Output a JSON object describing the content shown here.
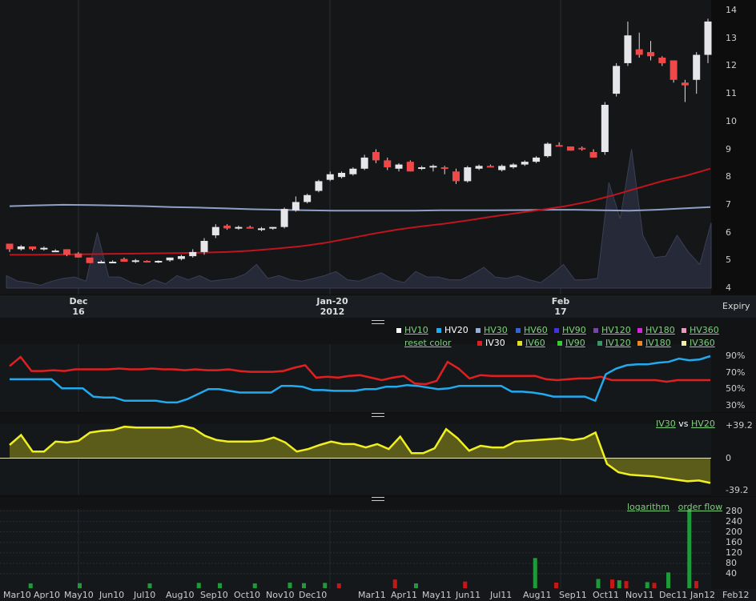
{
  "chart_data": [
    {
      "type": "candlestick",
      "title": "",
      "ylim": [
        4,
        14
      ],
      "y_ticks": [
        "14",
        "13",
        "12",
        "11",
        "10",
        "9",
        "8",
        "7",
        "6",
        "5",
        "4"
      ],
      "x_labels": [
        {
          "top": "Dec",
          "bottom": "16"
        },
        {
          "top": "Jan-20",
          "bottom": "2012"
        },
        {
          "top": "Feb",
          "bottom": "17"
        }
      ],
      "expiry_label": "Expiry",
      "candles": [
        [
          5.6,
          5.6,
          5.3,
          5.4
        ],
        [
          5.4,
          5.55,
          5.35,
          5.5
        ],
        [
          5.5,
          5.5,
          5.35,
          5.4
        ],
        [
          5.45,
          5.5,
          5.35,
          5.45
        ],
        [
          5.35,
          5.4,
          5.3,
          5.35
        ],
        [
          5.4,
          5.4,
          5.15,
          5.2
        ],
        [
          5.25,
          5.3,
          5.1,
          5.1
        ],
        [
          5.1,
          5.1,
          4.9,
          4.9
        ],
        [
          4.95,
          5.0,
          4.9,
          4.95
        ],
        [
          4.95,
          5.0,
          4.9,
          4.95
        ],
        [
          5.05,
          5.1,
          4.95,
          4.95
        ],
        [
          4.95,
          5.05,
          4.9,
          5.0
        ],
        [
          4.98,
          5.0,
          4.92,
          4.96
        ],
        [
          4.95,
          5.0,
          4.9,
          4.98
        ],
        [
          5.0,
          5.1,
          4.95,
          5.1
        ],
        [
          5.05,
          5.2,
          5.0,
          5.15
        ],
        [
          5.15,
          5.4,
          5.1,
          5.3
        ],
        [
          5.3,
          5.8,
          5.2,
          5.7
        ],
        [
          5.9,
          6.3,
          5.8,
          6.2
        ],
        [
          6.25,
          6.3,
          6.1,
          6.15
        ],
        [
          6.2,
          6.25,
          6.1,
          6.2
        ],
        [
          6.2,
          6.25,
          6.15,
          6.15
        ],
        [
          6.1,
          6.2,
          6.05,
          6.15
        ],
        [
          6.15,
          6.2,
          6.1,
          6.2
        ],
        [
          6.2,
          6.9,
          6.15,
          6.85
        ],
        [
          6.8,
          7.3,
          6.75,
          7.1
        ],
        [
          7.1,
          7.4,
          7.05,
          7.35
        ],
        [
          7.5,
          7.9,
          7.45,
          7.85
        ],
        [
          7.9,
          8.2,
          7.85,
          8.1
        ],
        [
          8.0,
          8.2,
          7.95,
          8.15
        ],
        [
          8.1,
          8.35,
          8.05,
          8.3
        ],
        [
          8.3,
          8.8,
          8.25,
          8.7
        ],
        [
          8.9,
          9.0,
          8.5,
          8.6
        ],
        [
          8.6,
          8.7,
          8.25,
          8.35
        ],
        [
          8.3,
          8.5,
          8.2,
          8.45
        ],
        [
          8.55,
          8.6,
          8.2,
          8.2
        ],
        [
          8.3,
          8.4,
          8.25,
          8.35
        ],
        [
          8.35,
          8.45,
          8.2,
          8.4
        ],
        [
          8.35,
          8.4,
          8.1,
          8.3
        ],
        [
          8.2,
          8.3,
          7.75,
          7.85
        ],
        [
          7.85,
          8.4,
          7.8,
          8.35
        ],
        [
          8.3,
          8.45,
          8.25,
          8.4
        ],
        [
          8.4,
          8.45,
          8.35,
          8.38
        ],
        [
          8.25,
          8.45,
          8.2,
          8.4
        ],
        [
          8.35,
          8.5,
          8.3,
          8.45
        ],
        [
          8.45,
          8.6,
          8.4,
          8.55
        ],
        [
          8.55,
          8.75,
          8.5,
          8.7
        ],
        [
          8.75,
          9.25,
          8.7,
          9.2
        ],
        [
          9.15,
          9.25,
          9.1,
          9.1
        ],
        [
          9.1,
          9.1,
          8.95,
          8.95
        ],
        [
          9.05,
          9.1,
          8.95,
          9.0
        ],
        [
          8.9,
          9.0,
          8.7,
          8.7
        ],
        [
          8.9,
          10.7,
          8.8,
          10.6
        ],
        [
          11.0,
          12.1,
          10.9,
          12.0
        ],
        [
          12.1,
          13.6,
          12.0,
          13.1
        ],
        [
          12.6,
          13.2,
          12.3,
          12.4
        ],
        [
          12.5,
          12.9,
          12.2,
          12.35
        ],
        [
          12.3,
          12.35,
          12.0,
          12.1
        ],
        [
          12.2,
          12.2,
          11.4,
          11.5
        ],
        [
          11.4,
          11.5,
          10.7,
          11.3
        ],
        [
          11.5,
          12.5,
          11.0,
          12.4
        ],
        [
          12.4,
          13.7,
          12.1,
          13.6
        ]
      ],
      "ma_red": [
        5.2,
        5.2,
        5.21,
        5.22,
        5.23,
        5.24,
        5.25,
        5.26,
        5.28,
        5.3,
        5.35,
        5.42,
        5.5,
        5.62,
        5.78,
        5.95,
        6.1,
        6.22,
        6.32,
        6.44,
        6.58,
        6.7,
        6.82,
        6.95,
        7.12,
        7.35,
        7.6,
        7.85,
        8.05,
        8.3
      ],
      "ma_blue": [
        6.95,
        6.98,
        7.0,
        6.99,
        6.97,
        6.95,
        6.92,
        6.9,
        6.87,
        6.84,
        6.82,
        6.8,
        6.79,
        6.79,
        6.79,
        6.79,
        6.8,
        6.8,
        6.8,
        6.81,
        6.82,
        6.82,
        6.8,
        6.79,
        6.82,
        6.87,
        6.92
      ],
      "volume_area": [
        4.45,
        4.25,
        4.2,
        4.1,
        4.25,
        4.35,
        4.4,
        4.25,
        6.0,
        4.4,
        4.4,
        4.2,
        4.1,
        4.3,
        4.15,
        4.45,
        4.3,
        4.45,
        4.25,
        4.3,
        4.35,
        4.5,
        4.85,
        4.35,
        4.45,
        4.3,
        4.25,
        4.35,
        4.45,
        4.6,
        4.3,
        4.25,
        4.4,
        4.55,
        4.3,
        4.2,
        4.6,
        4.4,
        4.4,
        4.3,
        4.3,
        4.5,
        4.75,
        4.4,
        4.35,
        4.45,
        4.3,
        4.2,
        4.5,
        4.85,
        4.3,
        4.3,
        4.35,
        7.8,
        6.5,
        9.0,
        5.9,
        5.1,
        5.15,
        5.9,
        5.3,
        4.85,
        6.35
      ]
    },
    {
      "type": "line",
      "title": "",
      "y_ticks": [
        "90%",
        "70%",
        "50%",
        "30%"
      ],
      "ylim": [
        30,
        90
      ],
      "series": [
        {
          "name": "IV30",
          "color": "#e02020",
          "values": [
            78,
            89,
            72,
            72,
            73,
            72,
            74,
            74,
            74,
            74,
            75,
            74,
            74,
            75,
            74,
            74,
            73,
            74,
            73,
            73,
            74,
            72,
            71,
            71,
            71,
            72,
            76,
            79,
            64,
            65,
            64,
            66,
            67,
            64,
            61,
            64,
            66,
            57,
            56,
            60,
            83,
            75,
            63,
            67,
            66,
            66,
            66,
            66,
            66,
            62,
            61,
            62,
            63,
            63,
            65,
            61,
            61,
            61,
            61,
            61,
            59,
            61,
            61,
            61,
            61
          ]
        },
        {
          "name": "HV20",
          "color": "#22aaee",
          "values": [
            62,
            62,
            62,
            62,
            62,
            51,
            51,
            51,
            41,
            40,
            40,
            36,
            36,
            36,
            36,
            34,
            34,
            38,
            44,
            50,
            50,
            48,
            46,
            46,
            46,
            46,
            54,
            54,
            53,
            49,
            49,
            48,
            48,
            48,
            50,
            50,
            53,
            53,
            55,
            54,
            52,
            50,
            51,
            54,
            54,
            54,
            54,
            54,
            47,
            47,
            46,
            44,
            41,
            41,
            41,
            41,
            36,
            68,
            75,
            79,
            80,
            80,
            82,
            83,
            87,
            85,
            86,
            90
          ]
        }
      ],
      "legend_row1": [
        {
          "label": "HV10",
          "color": "#ffffff",
          "link": true
        },
        {
          "label": "HV20",
          "color": "#22aaee",
          "link": false
        },
        {
          "label": "HV30",
          "color": "#9aaed8",
          "link": true
        },
        {
          "label": "HV60",
          "color": "#3366cc",
          "link": true
        },
        {
          "label": "HV90",
          "color": "#4433dd",
          "link": true
        },
        {
          "label": "HV120",
          "color": "#7744aa",
          "link": true
        },
        {
          "label": "HV180",
          "color": "#dd22dd",
          "link": true
        },
        {
          "label": "HV360",
          "color": "#ee99bb",
          "link": true
        }
      ],
      "legend_row2": [
        {
          "label": "reset color",
          "color": "",
          "link": true
        },
        {
          "label": "IV30",
          "color": "#e02020",
          "link": false
        },
        {
          "label": "IV60",
          "color": "#e0e020",
          "link": true
        },
        {
          "label": "IV90",
          "color": "#33cc33",
          "link": true
        },
        {
          "label": "IV120",
          "color": "#339966",
          "link": true
        },
        {
          "label": "IV180",
          "color": "#ee8822",
          "link": true
        },
        {
          "label": "IV360",
          "color": "#eeeeaa",
          "link": true
        }
      ]
    },
    {
      "type": "area",
      "title": "",
      "series_label_a": "IV30",
      "series_label_vs": "vs",
      "series_label_b": "HV20",
      "y_ticks": [
        "+39.2",
        "0",
        "-39.2"
      ],
      "ylim": [
        -39.2,
        39.2
      ],
      "values": [
        16,
        28,
        8,
        8,
        20,
        19,
        21,
        31,
        33,
        34,
        38,
        37,
        37,
        37,
        37,
        39,
        36,
        27,
        22,
        20,
        20,
        20,
        21,
        25,
        19,
        8,
        11,
        16,
        20,
        17,
        17,
        13,
        17,
        11,
        26,
        6,
        6,
        12,
        35,
        24,
        9,
        15,
        13,
        13,
        20,
        21,
        22,
        23,
        24,
        22,
        24,
        31,
        -7,
        -17,
        -20,
        -21,
        -22,
        -24,
        -26,
        -28,
        -27,
        -30
      ]
    },
    {
      "type": "bar",
      "title": "",
      "link_a": "logarithm",
      "link_b": "order flow",
      "y_ticks": [
        "280",
        "240",
        "200",
        "160",
        "120",
        "80",
        "40"
      ],
      "ylim": [
        0,
        300
      ],
      "x_labels": [
        "Mar10",
        "Apr10",
        "May10",
        "Jun10",
        "Jul10",
        "Aug10",
        "Sep10",
        "Oct10",
        "Nov10",
        "Dec10",
        "Mar11",
        "Apr11",
        "May11",
        "Jun11",
        "Jul11",
        "Aug11",
        "Sep11",
        "Oct11",
        "Nov11",
        "Dec11",
        "Jan12",
        "Feb12"
      ],
      "bars": [
        {
          "x": 3,
          "v": 3,
          "c": "g"
        },
        {
          "x": 10,
          "v": 4,
          "c": "g"
        },
        {
          "x": 20,
          "v": 3,
          "c": "g"
        },
        {
          "x": 27,
          "v": 5,
          "c": "g"
        },
        {
          "x": 30,
          "v": 4,
          "c": "g"
        },
        {
          "x": 35,
          "v": 3,
          "c": "g"
        },
        {
          "x": 40,
          "v": 6,
          "c": "g"
        },
        {
          "x": 42,
          "v": 4,
          "c": "g"
        },
        {
          "x": 45,
          "v": 5,
          "c": "g"
        },
        {
          "x": 47,
          "v": 3,
          "c": "r"
        },
        {
          "x": 55,
          "v": 18,
          "c": "r"
        },
        {
          "x": 58,
          "v": 3,
          "c": "g"
        },
        {
          "x": 65,
          "v": 10,
          "c": "r"
        },
        {
          "x": 75,
          "v": 100,
          "c": "g"
        },
        {
          "x": 78,
          "v": 6,
          "c": "r"
        },
        {
          "x": 84,
          "v": 20,
          "c": "g"
        },
        {
          "x": 86,
          "v": 18,
          "c": "r"
        },
        {
          "x": 87,
          "v": 15,
          "c": "g"
        },
        {
          "x": 88,
          "v": 12,
          "c": "r"
        },
        {
          "x": 91,
          "v": 8,
          "c": "g"
        },
        {
          "x": 92,
          "v": 5,
          "c": "r"
        },
        {
          "x": 94,
          "v": 45,
          "c": "g"
        },
        {
          "x": 97,
          "v": 285,
          "c": "g"
        },
        {
          "x": 98,
          "v": 12,
          "c": "r"
        }
      ]
    }
  ]
}
